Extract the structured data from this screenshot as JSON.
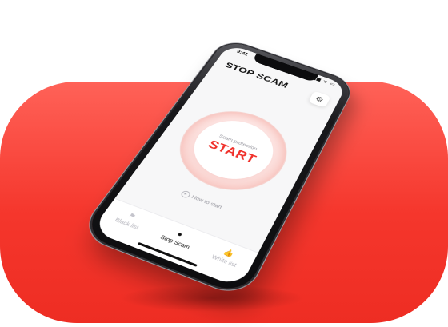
{
  "status_bar": {
    "time": "9:41",
    "icons": "▂▄▆ ᯤ ▭"
  },
  "app": {
    "title": "STOP SCAM",
    "settings_icon": "gear-icon"
  },
  "protection": {
    "caption": "Scam protection",
    "start_label": "START"
  },
  "help": {
    "link_label": "How to start"
  },
  "tabs": [
    {
      "label": "Black list",
      "icon": "flag-icon",
      "active": false
    },
    {
      "label": "Stop Scam",
      "icon": "dot-icon",
      "active": true
    },
    {
      "label": "White list",
      "icon": "thumbs-up-icon",
      "active": false
    }
  ],
  "colors": {
    "accent": "#f0302a",
    "background_pill": "#f5362c"
  }
}
